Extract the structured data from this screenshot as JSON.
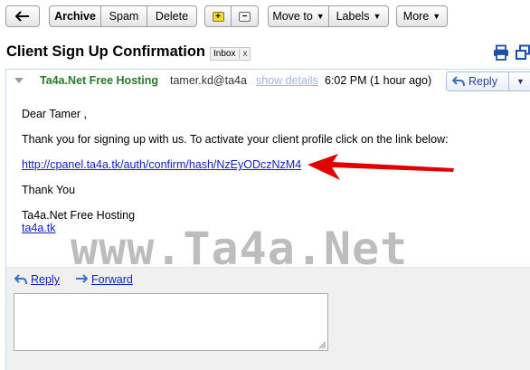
{
  "toolbar": {
    "back_icon": "back-arrow-icon",
    "archive_label": "Archive",
    "spam_label": "Spam",
    "delete_label": "Delete",
    "star_icon": "add-star-icon",
    "remove_icon": "remove-label-icon",
    "moveto_label": "Move to",
    "labels_label": "Labels",
    "more_label": "More"
  },
  "subject": {
    "title": "Client Sign Up Confirmation",
    "label": "Inbox",
    "label_close": "x"
  },
  "message": {
    "sender_name": "Ta4a.Net Free Hosting",
    "sender_email": "tamer.kd@ta4a",
    "show_details": "show details",
    "timestamp": "6:02 PM (1 hour ago)",
    "reply_label": "Reply",
    "body": {
      "greeting": "Dear Tamer ,",
      "intro": "Thank you for signing up with us. To activate your client profile click on the link below:",
      "link": "http://cpanel.ta4a.tk/auth/confirm/hash/NzEyODczNzM4",
      "thanks": "Thank You",
      "signature": "Ta4a.Net Free Hosting",
      "site_link": "ta4a.tk"
    }
  },
  "watermark": "www.Ta4a.Net",
  "reply_area": {
    "reply_label": "Reply",
    "forward_label": "Forward"
  },
  "colors": {
    "sender": "#2a7a2a",
    "link": "#1122cc",
    "arrow": "#e00000",
    "card_border": "#c3d9ff"
  }
}
